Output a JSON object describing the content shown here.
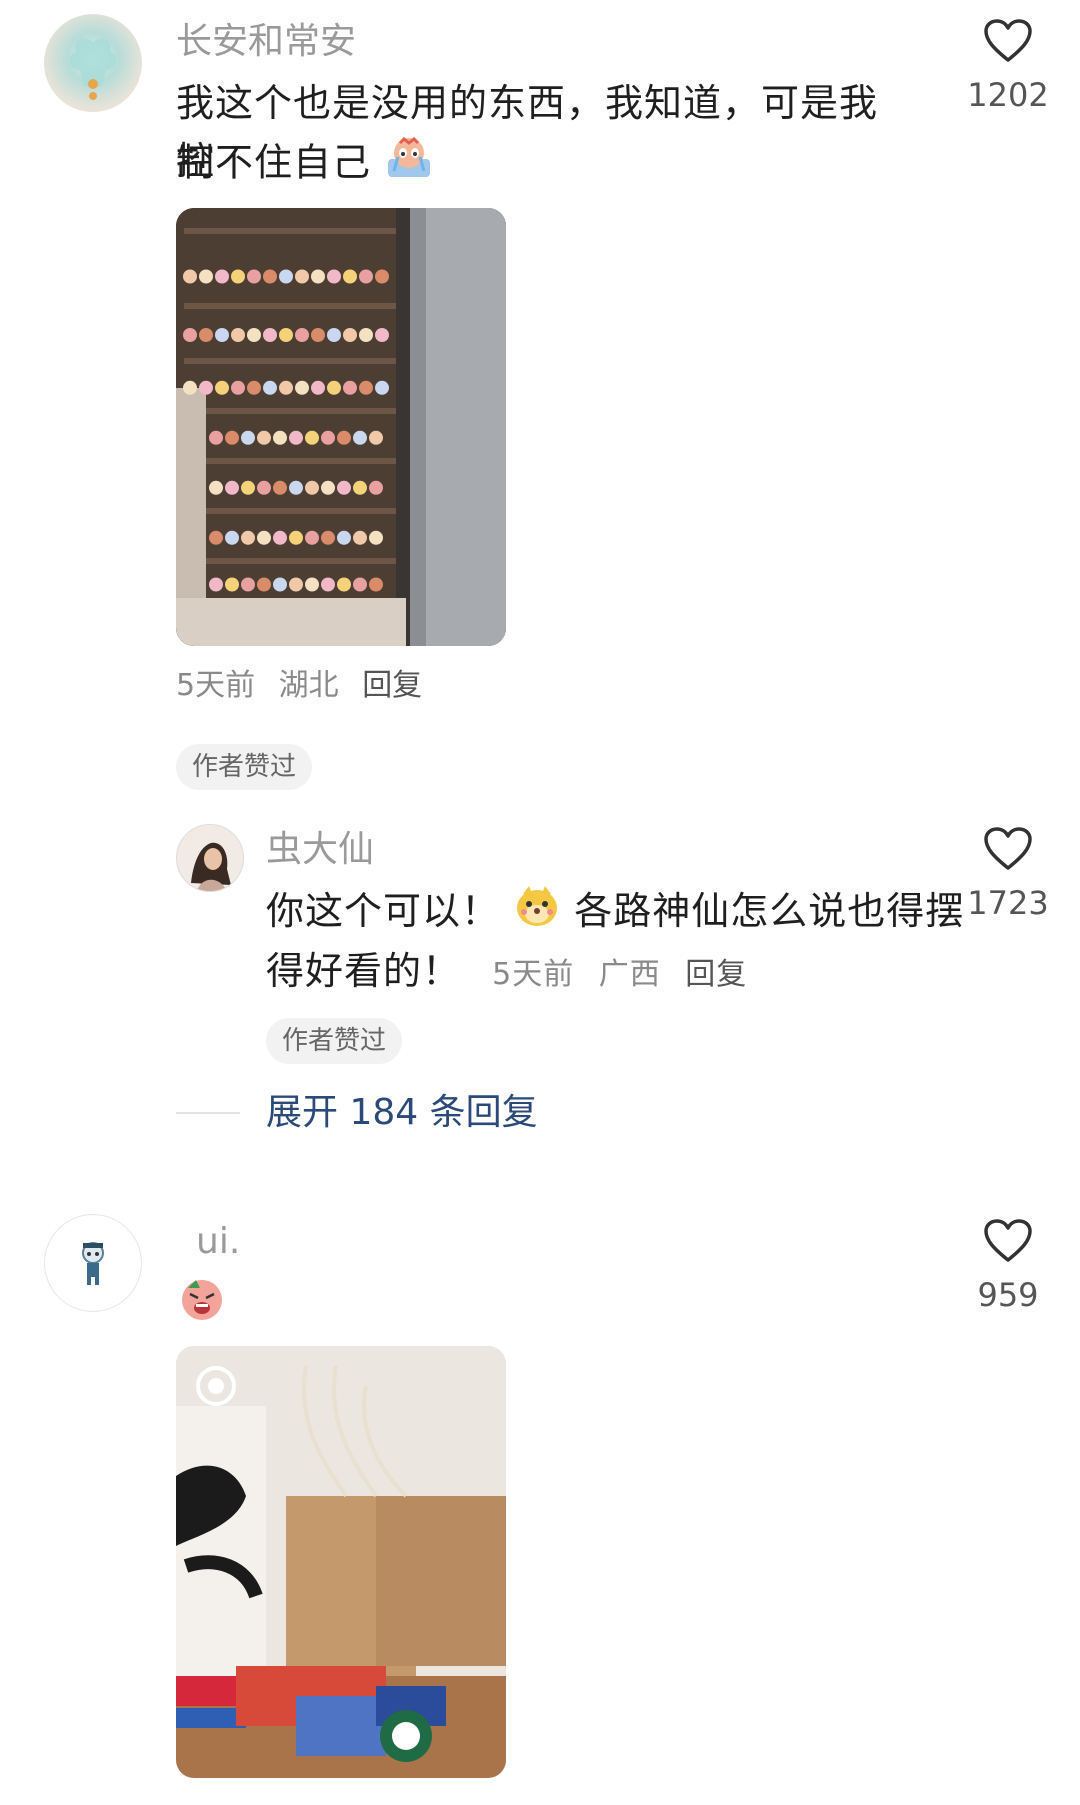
{
  "comments": [
    {
      "username": "长安和常安",
      "text_line1": "我这个也是没用的东西，我知道，可是我控",
      "text_line2": "制不住自己",
      "likes": "1202",
      "meta": {
        "time": "5天前",
        "location": "湖北",
        "reply": "回复"
      },
      "badge": "作者赞过",
      "image_desc_icon": "crying-emoji",
      "reply": {
        "username": "虫大仙",
        "text_part1": "你这个可以！",
        "text_part2": "各路神仙怎么说也得摆",
        "text_line2": "得好看的！",
        "meta": {
          "time": "5天前",
          "location": "广西",
          "reply": "回复"
        },
        "likes": "1723",
        "badge": "作者赞过"
      },
      "expand_label": "展开 184 条回复"
    },
    {
      "username": "ui.",
      "likes": "959"
    }
  ],
  "colors": {
    "accent_link": "#2b4a7a",
    "badge_bg": "#f2f2f2"
  }
}
